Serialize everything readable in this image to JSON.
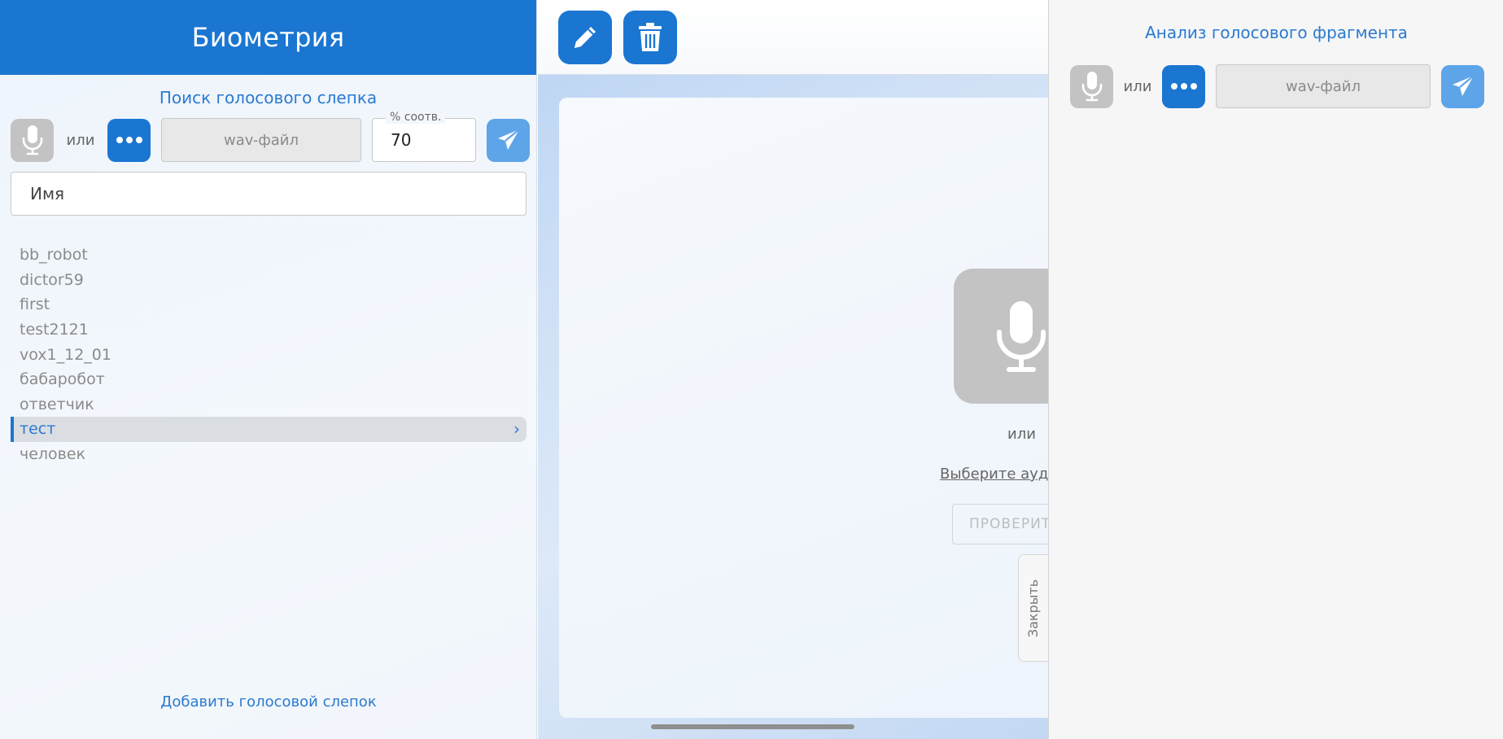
{
  "sidebar": {
    "title": "Биометрия",
    "search_title": "Поиск голосового слепка",
    "or_label": "или",
    "file_placeholder": "wav-файл",
    "percent_label": "% соотв.",
    "percent_value": "70",
    "name_placeholder": "Имя",
    "items": [
      {
        "label": "bb_robot"
      },
      {
        "label": "dictor59"
      },
      {
        "label": "first"
      },
      {
        "label": "test2121"
      },
      {
        "label": "vox1_12_01"
      },
      {
        "label": "бабаробот"
      },
      {
        "label": "ответчик"
      },
      {
        "label": "тест",
        "selected": true
      },
      {
        "label": "человек"
      }
    ],
    "add_link": "Добавить голосовой слепок"
  },
  "middle": {
    "or_label": "или",
    "choose_link": "Выберите аудио",
    "check_button": "ПРОВЕРИТЬ",
    "close_tab": "Закрыть"
  },
  "analysis": {
    "title": "Анализ голосового фрагмента",
    "or_label": "или",
    "file_placeholder": "wav-файл"
  },
  "icons": {
    "mic": "microphone-icon",
    "more": "more-dots-icon",
    "send": "paper-plane-icon",
    "edit": "pencil-icon",
    "delete": "trash-icon",
    "chevron": "chevron-right-icon"
  },
  "colors": {
    "primary": "#1b76d2",
    "accent_light": "#5ea4e8",
    "disabled": "#c3c3c3",
    "link": "#2b7ad0"
  }
}
